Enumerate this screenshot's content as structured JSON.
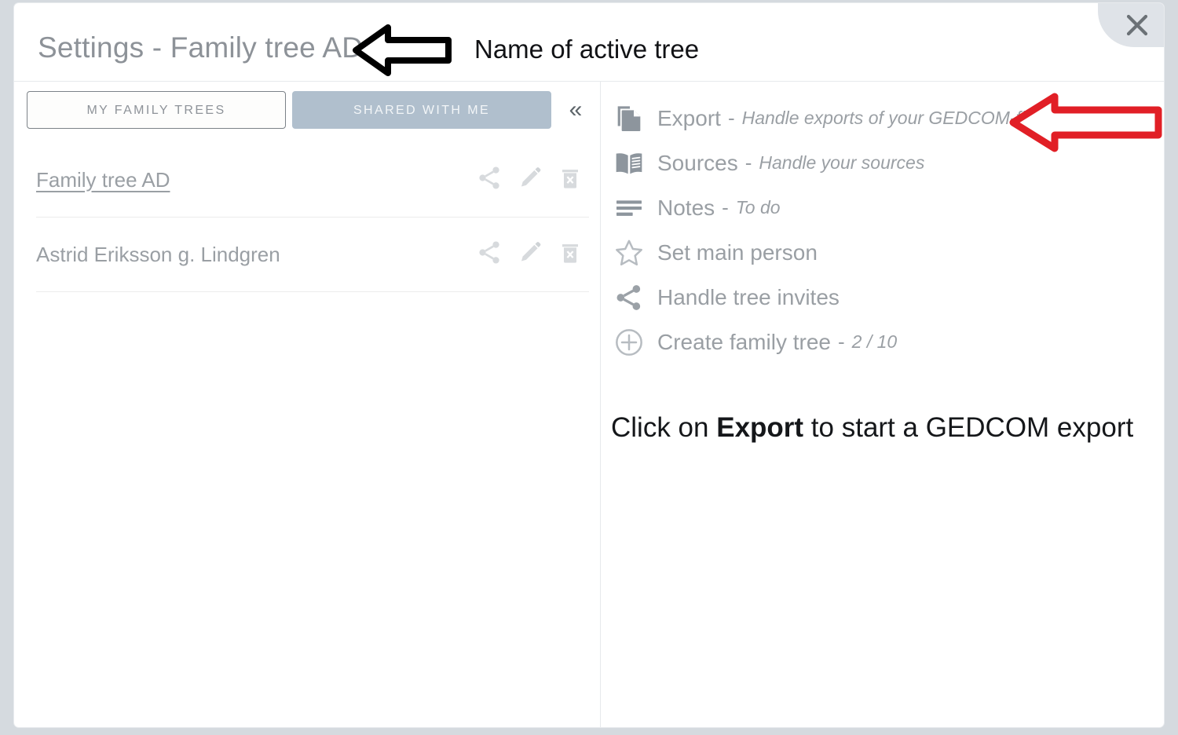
{
  "window": {
    "title": "Settings - Family tree AD",
    "close_icon": "close-icon"
  },
  "annotations": {
    "title_note": "Name of active tree",
    "bottom_note_prefix": "Click on ",
    "bottom_note_bold": "Export",
    "bottom_note_suffix": " to start a GEDCOM export",
    "black_arrow_icon": "left-arrow-annotation-icon",
    "red_arrow_icon": "left-arrow-annotation-icon",
    "red_arrow_color": "#e11f26",
    "black_arrow_color": "#000000"
  },
  "left_pane": {
    "tabs": [
      {
        "label": "MY FAMILY TREES",
        "state": "inactive"
      },
      {
        "label": "SHARED WITH ME",
        "state": "active"
      }
    ],
    "collapse_icon": "chevron-double-left-icon",
    "collapse_glyph": "«",
    "trees": [
      {
        "name": "Family tree AD",
        "active": true,
        "actions": [
          "share-icon",
          "edit-icon",
          "delete-icon"
        ]
      },
      {
        "name": "Astrid Eriksson g. Lindgren",
        "active": false,
        "actions": [
          "share-icon",
          "edit-icon",
          "delete-icon"
        ]
      }
    ]
  },
  "right_pane": {
    "menu": [
      {
        "icon": "copy-documents-icon",
        "label": "Export",
        "separator": "-",
        "sublabel": "Handle exports of your GEDCOM-file"
      },
      {
        "icon": "open-book-icon",
        "label": "Sources",
        "separator": "-",
        "sublabel": "Handle your sources"
      },
      {
        "icon": "list-lines-icon",
        "label": "Notes",
        "separator": "-",
        "sublabel": "To do"
      },
      {
        "icon": "star-icon",
        "label": "Set main person",
        "separator": "",
        "sublabel": ""
      },
      {
        "icon": "share-icon",
        "label": "Handle tree invites",
        "separator": "",
        "sublabel": ""
      },
      {
        "icon": "plus-circle-icon",
        "label": "Create family tree",
        "separator": "-",
        "sublabel": "2 / 10"
      }
    ]
  },
  "colors": {
    "page_background": "#d5dadf",
    "dialog_background": "#ffffff",
    "muted_text": "#9a9fa4",
    "title_text": "#8d9298",
    "active_tab_background": "#b0bfcd",
    "divider": "#e6e9ec",
    "icon_gray": "#8d959d"
  }
}
